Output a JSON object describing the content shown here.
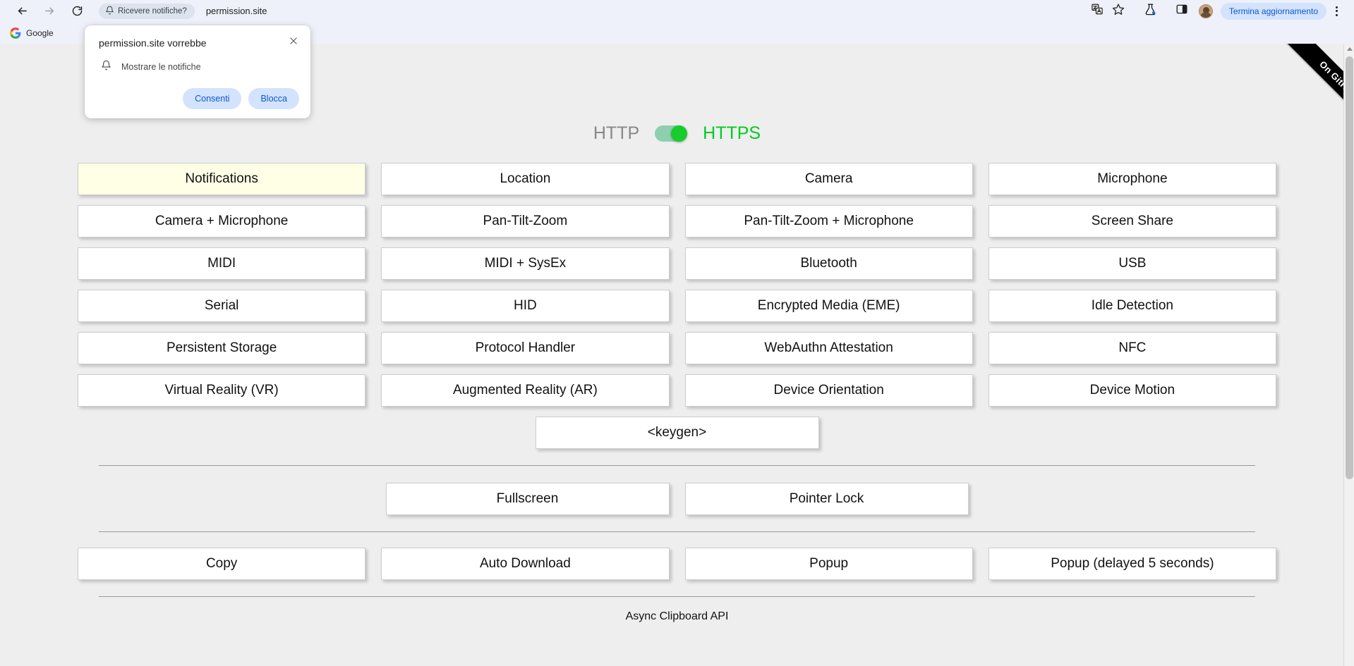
{
  "browser": {
    "back_icon": "back-arrow-icon",
    "forward_icon": "forward-arrow-icon",
    "reload_icon": "reload-icon",
    "omnibox": {
      "permission_chip_label": "Ricevere notifiche?",
      "permission_chip_icon": "bell-icon",
      "url": "permission.site"
    },
    "right_icons": [
      {
        "name": "translate-icon",
        "label": "Traduci"
      },
      {
        "name": "bookmark-star-icon",
        "label": "Aggiungi ai preferiti"
      },
      {
        "name": "labs-flask-icon",
        "label": "Funzionalità sperimentali"
      },
      {
        "name": "side-panel-icon",
        "label": "Riquadro laterale"
      }
    ],
    "avatar_label": "Profilo",
    "update_button_label": "Termina aggiornamento",
    "menu_label": "Personalizza e controlla Google Chrome",
    "bookmarks": [
      {
        "name": "google-bookmark",
        "label": "Google"
      }
    ]
  },
  "permission_bubble": {
    "title": "permission.site vorrebbe",
    "close_label": "Chiudi",
    "item_icon": "bell-icon",
    "item_label": "Mostrare le notifiche",
    "allow_label": "Consenti",
    "block_label": "Blocca"
  },
  "page": {
    "ribbon_label": "On GitHub",
    "protocol": {
      "http_label": "HTTP",
      "https_label": "HTTPS",
      "active": "HTTPS",
      "toggle_on": true,
      "active_color": "#00cc22",
      "inactive_color": "#888888"
    },
    "active_button": "Notifications",
    "active_button_color": "#ffffe6",
    "permission_buttons": [
      "Notifications",
      "Location",
      "Camera",
      "Microphone",
      "Camera + Microphone",
      "Pan-Tilt-Zoom",
      "Pan-Tilt-Zoom + Microphone",
      "Screen Share",
      "MIDI",
      "MIDI + SysEx",
      "Bluetooth",
      "USB",
      "Serial",
      "HID",
      "Encrypted Media (EME)",
      "Idle Detection",
      "Persistent Storage",
      "Protocol Handler",
      "WebAuthn Attestation",
      "NFC",
      "Virtual Reality (VR)",
      "Augmented Reality (AR)",
      "Device Orientation",
      "Device Motion"
    ],
    "keygen_button": "<keygen>",
    "display_buttons": [
      "Fullscreen",
      "Pointer Lock"
    ],
    "misc_buttons": [
      "Copy",
      "Auto Download",
      "Popup",
      "Popup (delayed 5 seconds)"
    ],
    "footer_note": "Async Clipboard API"
  }
}
